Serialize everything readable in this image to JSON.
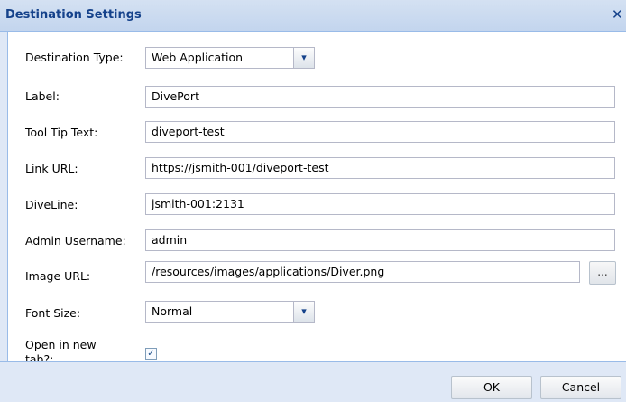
{
  "dialog": {
    "title": "Destination Settings",
    "close_icon": "close-icon"
  },
  "form": {
    "destination_type": {
      "label": "Destination Type:",
      "value": "Web Application"
    },
    "label_field": {
      "label": "Label:",
      "value": "DivePort"
    },
    "tooltip": {
      "label": "Tool Tip Text:",
      "value": "diveport-test"
    },
    "link_url": {
      "label": "Link URL:",
      "value": "https://jsmith-001/diveport-test"
    },
    "diveline": {
      "label": "DiveLine:",
      "value": "jsmith-001:2131"
    },
    "admin_username": {
      "label": "Admin Username:",
      "value": "admin"
    },
    "image_url": {
      "label": "Image URL:",
      "value": "/resources/images/applications/Diver.png",
      "browse_label": "..."
    },
    "font_size": {
      "label": "Font Size:",
      "value": "Normal"
    },
    "open_new_tab": {
      "label": "Open in new tab?:",
      "checked": true
    }
  },
  "footer": {
    "ok_label": "OK",
    "cancel_label": "Cancel"
  },
  "colors": {
    "header_text": "#15428b",
    "body_bg": "#ffffff",
    "frame_bg": "#dfe8f6",
    "border": "#99bbe8"
  }
}
